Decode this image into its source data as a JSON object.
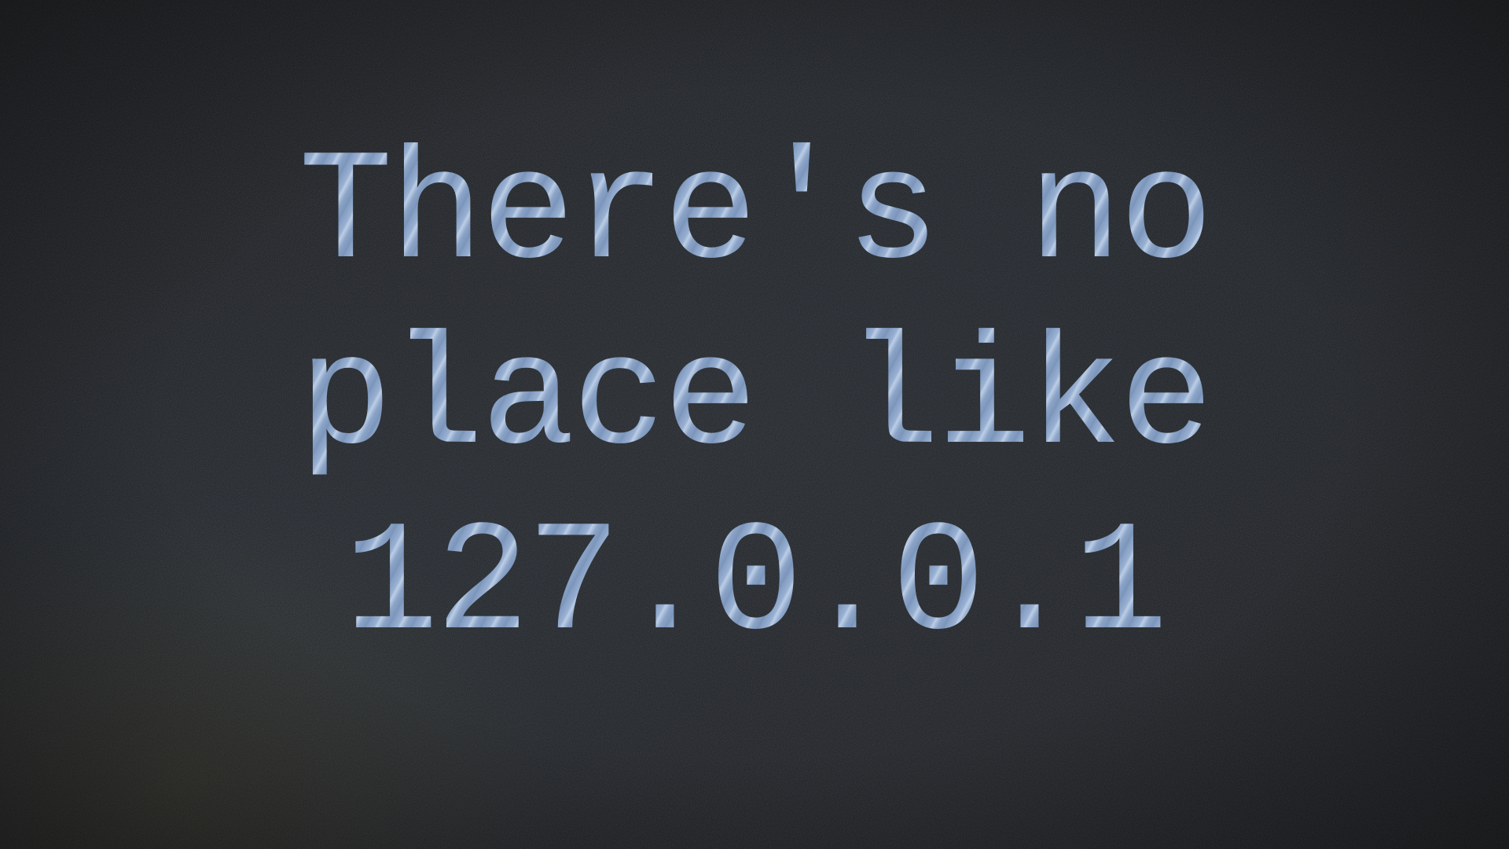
{
  "message": {
    "lines": [
      "There's no",
      "place like",
      "127.0.0.1"
    ]
  },
  "colors": {
    "background": "#1b1d21",
    "text": "#8ea6c9"
  }
}
